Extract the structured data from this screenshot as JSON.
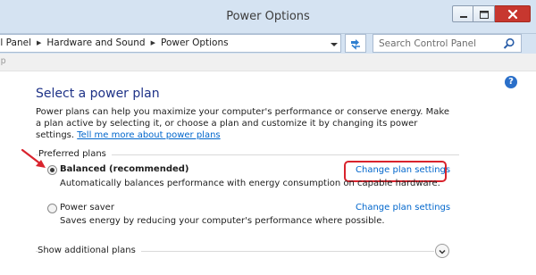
{
  "window": {
    "title": "Power Options"
  },
  "address_bar": {
    "crumbs": [
      "ol Panel",
      "Hardware and Sound",
      "Power Options"
    ]
  },
  "search": {
    "placeholder": "Search Control Panel"
  },
  "menu": {
    "help_label": "lp"
  },
  "content": {
    "heading": "Select a power plan",
    "intro_text": "Power plans can help you maximize your computer's performance or conserve energy. Make a plan active by selecting it, or choose a plan and customize it by changing its power settings. ",
    "intro_link": "Tell me more about power plans",
    "preferred_label": "Preferred plans",
    "plans": [
      {
        "name": "Balanced (recommended)",
        "description": "Automatically balances performance with energy consumption on capable hardware.",
        "change_link": "Change plan settings",
        "selected": true
      },
      {
        "name": "Power saver",
        "description": "Saves energy by reducing your computer's performance where possible.",
        "change_link": "Change plan settings",
        "selected": false
      }
    ],
    "additional_label": "Show additional plans"
  },
  "colors": {
    "titlebar": "#d5e3f2",
    "heading": "#1e3287",
    "link": "#0066cc",
    "highlight": "#d9232d",
    "close_button": "#c7372f"
  }
}
